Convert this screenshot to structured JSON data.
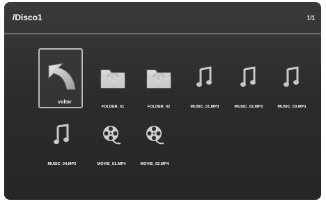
{
  "header": {
    "path": "/Disco1",
    "page": "1/1"
  },
  "items": [
    {
      "label": "voltar",
      "icon": "back-arrow-icon",
      "type": "back"
    },
    {
      "label": "FOLDER_01",
      "icon": "folder-icon",
      "type": "folder"
    },
    {
      "label": "FOLDER_02",
      "icon": "folder-icon",
      "type": "folder"
    },
    {
      "label": "MUSIC_01.MP3",
      "icon": "music-note-icon",
      "type": "music"
    },
    {
      "label": "MUSIC_02.MP3",
      "icon": "music-note-icon",
      "type": "music"
    },
    {
      "label": "MUSIC_03.MP3",
      "icon": "music-note-icon",
      "type": "music"
    },
    {
      "label": "MUSIC_04.MP3",
      "icon": "music-note-icon",
      "type": "music"
    },
    {
      "label": "MOVIE_01.MP4",
      "icon": "film-reel-icon",
      "type": "movie"
    },
    {
      "label": "MOVIE_02.MP4",
      "icon": "film-reel-icon",
      "type": "movie"
    }
  ],
  "colors": {
    "background": "#2c2c2c",
    "text": "#ffffff",
    "selection_border": "#b8b8b8"
  }
}
